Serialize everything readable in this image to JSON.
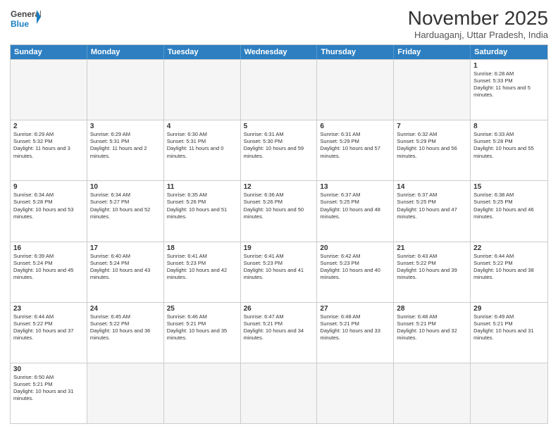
{
  "logo": {
    "text_general": "General",
    "text_blue": "Blue"
  },
  "header": {
    "month": "November 2025",
    "location": "Harduaganj, Uttar Pradesh, India"
  },
  "days_of_week": [
    "Sunday",
    "Monday",
    "Tuesday",
    "Wednesday",
    "Thursday",
    "Friday",
    "Saturday"
  ],
  "weeks": [
    [
      {
        "day": "",
        "empty": true
      },
      {
        "day": "",
        "empty": true
      },
      {
        "day": "",
        "empty": true
      },
      {
        "day": "",
        "empty": true
      },
      {
        "day": "",
        "empty": true
      },
      {
        "day": "",
        "empty": true
      },
      {
        "day": "1",
        "sunrise": "6:28 AM",
        "sunset": "5:33 PM",
        "daylight": "11 hours and 5 minutes."
      }
    ],
    [
      {
        "day": "2",
        "sunrise": "6:29 AM",
        "sunset": "5:32 PM",
        "daylight": "11 hours and 3 minutes."
      },
      {
        "day": "3",
        "sunrise": "6:29 AM",
        "sunset": "5:31 PM",
        "daylight": "11 hours and 2 minutes."
      },
      {
        "day": "4",
        "sunrise": "6:30 AM",
        "sunset": "5:31 PM",
        "daylight": "11 hours and 0 minutes."
      },
      {
        "day": "5",
        "sunrise": "6:31 AM",
        "sunset": "5:30 PM",
        "daylight": "10 hours and 59 minutes."
      },
      {
        "day": "6",
        "sunrise": "6:31 AM",
        "sunset": "5:29 PM",
        "daylight": "10 hours and 57 minutes."
      },
      {
        "day": "7",
        "sunrise": "6:32 AM",
        "sunset": "5:29 PM",
        "daylight": "10 hours and 56 minutes."
      },
      {
        "day": "8",
        "sunrise": "6:33 AM",
        "sunset": "5:28 PM",
        "daylight": "10 hours and 55 minutes."
      }
    ],
    [
      {
        "day": "9",
        "sunrise": "6:34 AM",
        "sunset": "5:28 PM",
        "daylight": "10 hours and 53 minutes."
      },
      {
        "day": "10",
        "sunrise": "6:34 AM",
        "sunset": "5:27 PM",
        "daylight": "10 hours and 52 minutes."
      },
      {
        "day": "11",
        "sunrise": "6:35 AM",
        "sunset": "5:26 PM",
        "daylight": "10 hours and 51 minutes."
      },
      {
        "day": "12",
        "sunrise": "6:36 AM",
        "sunset": "5:26 PM",
        "daylight": "10 hours and 50 minutes."
      },
      {
        "day": "13",
        "sunrise": "6:37 AM",
        "sunset": "5:25 PM",
        "daylight": "10 hours and 48 minutes."
      },
      {
        "day": "14",
        "sunrise": "6:37 AM",
        "sunset": "5:25 PM",
        "daylight": "10 hours and 47 minutes."
      },
      {
        "day": "15",
        "sunrise": "6:38 AM",
        "sunset": "5:25 PM",
        "daylight": "10 hours and 46 minutes."
      }
    ],
    [
      {
        "day": "16",
        "sunrise": "6:39 AM",
        "sunset": "5:24 PM",
        "daylight": "10 hours and 45 minutes."
      },
      {
        "day": "17",
        "sunrise": "6:40 AM",
        "sunset": "5:24 PM",
        "daylight": "10 hours and 43 minutes."
      },
      {
        "day": "18",
        "sunrise": "6:41 AM",
        "sunset": "5:23 PM",
        "daylight": "10 hours and 42 minutes."
      },
      {
        "day": "19",
        "sunrise": "6:41 AM",
        "sunset": "5:23 PM",
        "daylight": "10 hours and 41 minutes."
      },
      {
        "day": "20",
        "sunrise": "6:42 AM",
        "sunset": "5:23 PM",
        "daylight": "10 hours and 40 minutes."
      },
      {
        "day": "21",
        "sunrise": "6:43 AM",
        "sunset": "5:22 PM",
        "daylight": "10 hours and 39 minutes."
      },
      {
        "day": "22",
        "sunrise": "6:44 AM",
        "sunset": "5:22 PM",
        "daylight": "10 hours and 38 minutes."
      }
    ],
    [
      {
        "day": "23",
        "sunrise": "6:44 AM",
        "sunset": "5:22 PM",
        "daylight": "10 hours and 37 minutes."
      },
      {
        "day": "24",
        "sunrise": "6:45 AM",
        "sunset": "5:22 PM",
        "daylight": "10 hours and 36 minutes."
      },
      {
        "day": "25",
        "sunrise": "6:46 AM",
        "sunset": "5:21 PM",
        "daylight": "10 hours and 35 minutes."
      },
      {
        "day": "26",
        "sunrise": "6:47 AM",
        "sunset": "5:21 PM",
        "daylight": "10 hours and 34 minutes."
      },
      {
        "day": "27",
        "sunrise": "6:48 AM",
        "sunset": "5:21 PM",
        "daylight": "10 hours and 33 minutes."
      },
      {
        "day": "28",
        "sunrise": "6:48 AM",
        "sunset": "5:21 PM",
        "daylight": "10 hours and 32 minutes."
      },
      {
        "day": "29",
        "sunrise": "6:49 AM",
        "sunset": "5:21 PM",
        "daylight": "10 hours and 31 minutes."
      }
    ],
    [
      {
        "day": "30",
        "sunrise": "6:50 AM",
        "sunset": "5:21 PM",
        "daylight": "10 hours and 31 minutes."
      },
      {
        "day": "",
        "empty": true
      },
      {
        "day": "",
        "empty": true
      },
      {
        "day": "",
        "empty": true
      },
      {
        "day": "",
        "empty": true
      },
      {
        "day": "",
        "empty": true
      },
      {
        "day": "",
        "empty": true
      }
    ]
  ]
}
